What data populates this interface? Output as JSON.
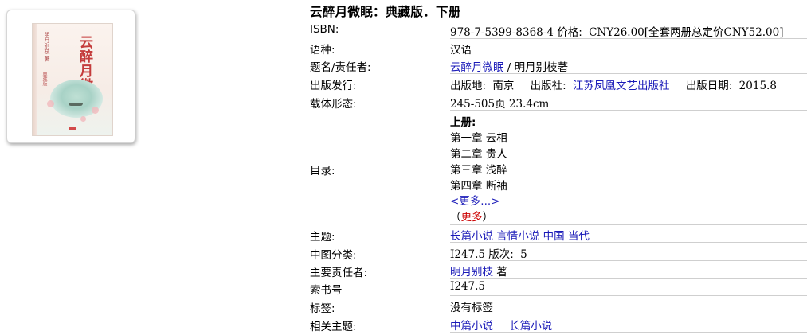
{
  "book": {
    "title": "云醉月微眠：典藏版．下册",
    "cover": {
      "title_art": "云醉月微眠",
      "subtitle_art": "明月别枝 著",
      "label_art": "典藏版"
    }
  },
  "fields": {
    "isbn": {
      "label": "ISBN:",
      "number": "978-7-5399-8368-4",
      "price_label": "价格:",
      "price": "CNY26.00[全套两册总定价CNY52.00]"
    },
    "language": {
      "label": "语种:",
      "value": "汉语"
    },
    "title_resp": {
      "label": "题名/责任者:",
      "title_link": "云醉月微眠",
      "resp": " / 明月别枝著"
    },
    "publication": {
      "label": "出版发行:",
      "place_label": "出版地:",
      "place": "南京",
      "publisher_label": "出版社:",
      "publisher": "江苏凤凰文艺出版社",
      "date_label": "出版日期:",
      "date": "2015.8"
    },
    "physical": {
      "label": "载体形态:",
      "value": "245-505页 23.4cm"
    },
    "toc": {
      "label": "目录:",
      "heading": "上册:",
      "chapters": [
        "第一章 云相",
        "第二章 贵人",
        "第三章 浅醉",
        "第四章 断袖"
      ],
      "more_link": "<更多...>",
      "more_open": "（",
      "more_red": "更多",
      "more_close": "）"
    },
    "subject": {
      "label": "主题:",
      "links": [
        "长篇小说",
        "言情小说",
        "中国",
        "当代"
      ]
    },
    "clc": {
      "label": "中图分类:",
      "class": "I247.5",
      "edition_label": "版次:",
      "edition": "5"
    },
    "main_resp": {
      "label": "主要责任者:",
      "name_link": "明月别枝",
      "role": " 著"
    },
    "call_number": {
      "label": "索书号",
      "value": "I247.5"
    },
    "tags": {
      "label": "标签:",
      "value": "没有标签"
    },
    "related": {
      "label": "相关主题:",
      "links": [
        "中篇小说",
        "长篇小说"
      ]
    }
  },
  "colors": {
    "link": "#1a1ab8",
    "more_red": "#cc0000",
    "row_rule": "#cfcfcf"
  }
}
